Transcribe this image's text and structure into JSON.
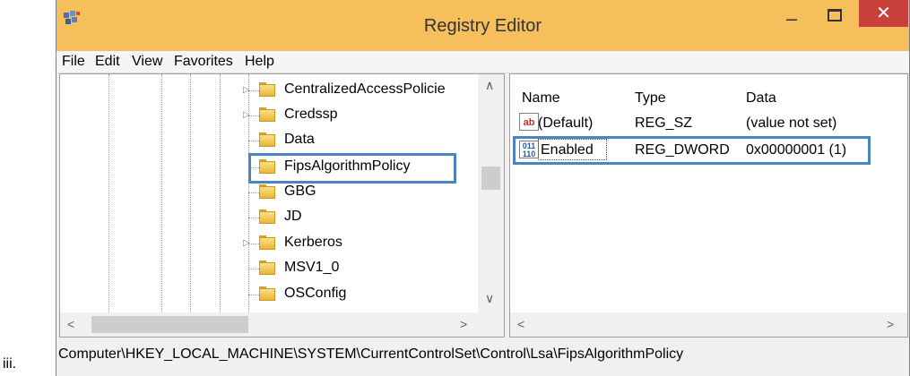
{
  "outer_label": "iii.",
  "window": {
    "title": "Registry Editor",
    "minimize_glyph": "–",
    "close_glyph": "✕",
    "accent": "#f6bf5c",
    "close_color": "#c7403a",
    "highlight_color": "#4c83c4"
  },
  "menu": [
    "File",
    "Edit",
    "View",
    "Favorites",
    "Help"
  ],
  "tree": {
    "items": [
      {
        "label": "CentralizedAccessPolicie",
        "expandable": true
      },
      {
        "label": "Credssp",
        "expandable": true
      },
      {
        "label": "Data",
        "expandable": false
      },
      {
        "label": "FipsAlgorithmPolicy",
        "expandable": false,
        "selected": true
      },
      {
        "label": "GBG",
        "expandable": false
      },
      {
        "label": "JD",
        "expandable": false
      },
      {
        "label": "Kerberos",
        "expandable": true
      },
      {
        "label": "MSV1_0",
        "expandable": false
      },
      {
        "label": "OSConfig",
        "expandable": false
      }
    ],
    "scroll_up": "∧",
    "scroll_down": "∨",
    "scroll_left": "<",
    "scroll_right": ">"
  },
  "values": {
    "columns": [
      "Name",
      "Type",
      "Data"
    ],
    "rows": [
      {
        "icon": "string-value-icon",
        "icon_text": "ab",
        "name": "(Default)",
        "type": "REG_SZ",
        "data": "(value not set)"
      },
      {
        "icon": "binary-value-icon",
        "icon_text": "011\n110",
        "name": "Enabled",
        "type": "REG_DWORD",
        "data": "0x00000001 (1)",
        "selected": true
      }
    ],
    "scroll_left": "<",
    "scroll_right": ">"
  },
  "status": {
    "path": "Computer\\HKEY_LOCAL_MACHINE\\SYSTEM\\CurrentControlSet\\Control\\Lsa\\FipsAlgorithmPolicy"
  }
}
